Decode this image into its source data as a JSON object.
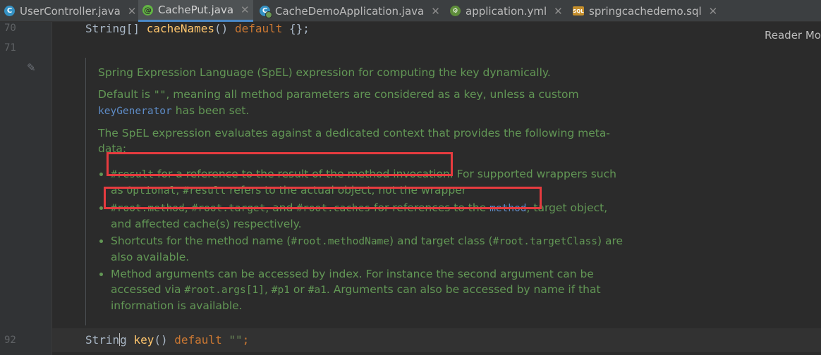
{
  "tabs": [
    {
      "label": "UserController.java",
      "icon": "java-class-icon",
      "active": false
    },
    {
      "label": "CachePut.java",
      "icon": "annotation-icon",
      "active": true
    },
    {
      "label": "CacheDemoApplication.java",
      "icon": "spring-boot-class-icon",
      "active": false
    },
    {
      "label": "application.yml",
      "icon": "spring-config-icon",
      "active": false
    },
    {
      "label": "springcachedemo.sql",
      "icon": "sql-file-icon",
      "active": false
    }
  ],
  "gutter": {
    "line_70": "70",
    "line_71": "71",
    "line_92": "92"
  },
  "code": {
    "line70_type": "String[]",
    "line70_method": "cacheNames",
    "line70_rest": "()",
    "line70_kw": "default",
    "line70_val": "{};",
    "line92_type_a": "Strin",
    "line92_type_b": "g",
    "line92_method": "key",
    "line92_rest": "()",
    "line92_kw": "default",
    "line92_str": "\"\"",
    "line92_end": ";"
  },
  "reader_mode": "Reader Mo",
  "doc": {
    "p1": "Spring Expression Language (SpEL) expression for computing the key dynamically.",
    "p2a": "Default is ",
    "p2b": "\"\"",
    "p2c": ", meaning all method parameters are considered as a key, unless a custom",
    "p2link": "keyGenerator",
    "p2d": " has been set.",
    "p3": "The SpEL expression evaluates against a dedicated context that provides the following meta-data:",
    "b1_code": "#result",
    "b1_text": " for a reference to the result of the method invocation. For supported wrappers such as ",
    "b1_code2": "Optional",
    "b1_sep": ", ",
    "b1_code3": "#result",
    "b1_tail": " refers to the actual object, not the wrapper",
    "b2_code1": "#root.method",
    "b2_sep1": ", ",
    "b2_code2": "#root.target",
    "b2_sep2": ", and ",
    "b2_code3": "#root.caches",
    "b2_text": " for references to the ",
    "b2_link": "method",
    "b2_tail": ", target object, and affected cache(s) respectively.",
    "b3_a": "Shortcuts for the method name (",
    "b3_code1": "#root.methodName",
    "b3_b": ") and target class (",
    "b3_code2": "#root.targetClass",
    "b3_c": ") are also available.",
    "b4_a": "Method arguments can be accessed by index. For instance the second argument can be accessed via ",
    "b4_code1": "#root.args[1]",
    "b4_s1": ", ",
    "b4_code2": "#p1",
    "b4_s2": " or ",
    "b4_code3": "#a1",
    "b4_tail": ". Arguments can also be accessed by name if that information is available."
  },
  "colors": {
    "highlight_box": "#e63b3f",
    "doc_text": "#629755",
    "keyword": "#cc7832",
    "link": "#5e8cc7"
  }
}
